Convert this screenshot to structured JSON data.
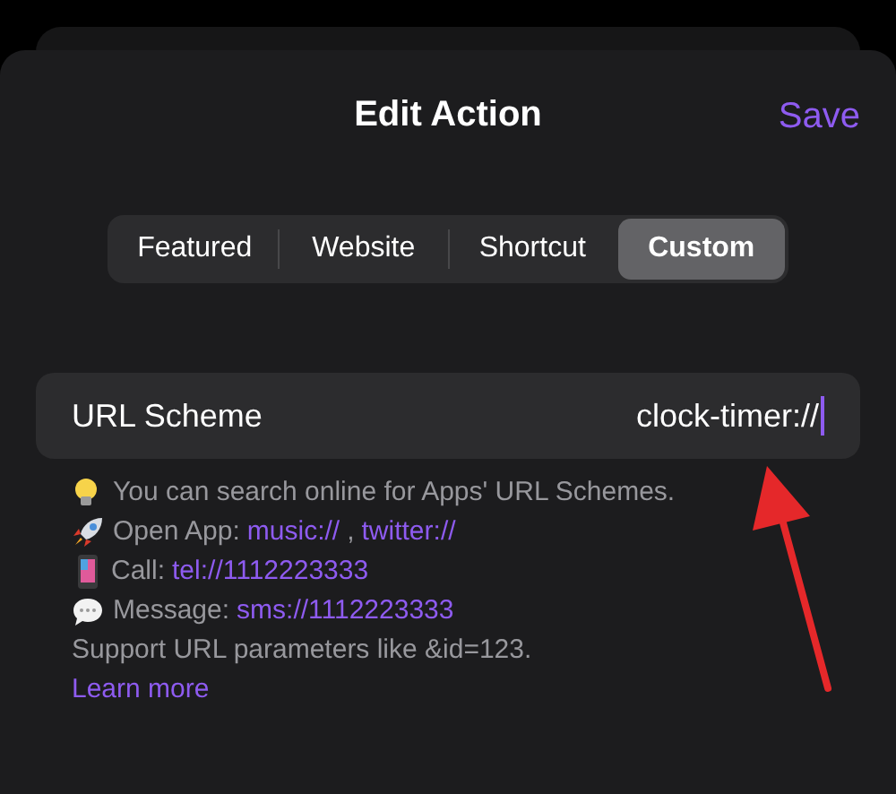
{
  "header": {
    "title": "Edit Action",
    "save": "Save"
  },
  "tabs": [
    {
      "label": "Featured",
      "selected": false
    },
    {
      "label": "Website",
      "selected": false
    },
    {
      "label": "Shortcut",
      "selected": false
    },
    {
      "label": "Custom",
      "selected": true
    }
  ],
  "field": {
    "label": "URL Scheme",
    "value": "clock-timer://",
    "focused": true
  },
  "help_lines": [
    {
      "kind": "bulb",
      "segments": [
        {
          "text": "You can search online for Apps' URL Schemes.",
          "link": false
        }
      ]
    },
    {
      "kind": "rocket",
      "segments": [
        {
          "text": "Open App:",
          "link": false
        },
        {
          "text": "music://",
          "link": true
        },
        {
          "text": ",",
          "link": false
        },
        {
          "text": "twitter://",
          "link": true
        }
      ]
    },
    {
      "kind": "phone",
      "segments": [
        {
          "text": "Call:",
          "link": false
        },
        {
          "text": "tel://1112223333",
          "link": true
        }
      ]
    },
    {
      "kind": "bubble",
      "segments": [
        {
          "text": "Message:",
          "link": false
        },
        {
          "text": "sms://1112223333",
          "link": true
        }
      ]
    },
    {
      "kind": "plain",
      "segments": [
        {
          "text": "Support URL parameters like &id=123.",
          "link": false
        }
      ]
    },
    {
      "kind": "plain",
      "segments": [
        {
          "text": "Learn more",
          "link": true
        }
      ]
    }
  ]
}
